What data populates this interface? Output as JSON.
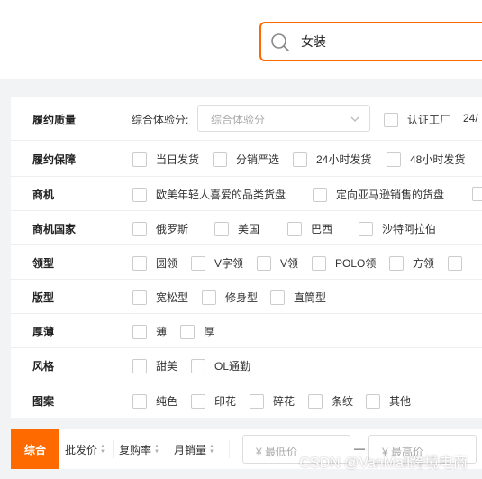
{
  "search": {
    "query": "女装"
  },
  "filters": {
    "fulfillment_quality": {
      "label": "履约质量",
      "select_label": "综合体验分:",
      "select_value": "综合体验分",
      "options": [
        "认证工厂",
        "24/"
      ]
    },
    "fulfillment_guarantee": {
      "label": "履约保障",
      "options": [
        "当日发货",
        "分销严选",
        "24小时发货",
        "48小时发货"
      ]
    },
    "opportunity": {
      "label": "商机",
      "options": [
        "欧美年轻人喜爱的品类货盘",
        "定向亚马逊销售的货盘"
      ]
    },
    "opportunity_country": {
      "label": "商机国家",
      "options": [
        "俄罗斯",
        "美国",
        "巴西",
        "沙特阿拉伯"
      ]
    },
    "collar": {
      "label": "领型",
      "options": [
        "圆领",
        "V字领",
        "V领",
        "POLO领",
        "方领",
        "一"
      ]
    },
    "fit": {
      "label": "版型",
      "options": [
        "宽松型",
        "修身型",
        "直筒型"
      ]
    },
    "thickness": {
      "label": "厚薄",
      "options": [
        "薄",
        "厚"
      ]
    },
    "style": {
      "label": "风格",
      "options": [
        "甜美",
        "OL通勤"
      ]
    },
    "pattern": {
      "label": "图案",
      "options": [
        "纯色",
        "印花",
        "碎花",
        "条纹",
        "其他"
      ]
    }
  },
  "sort": {
    "active": "综合",
    "items": [
      "批发价",
      "复购率",
      "月销量"
    ],
    "min_price_placeholder": "¥ 最低价",
    "separator": "—",
    "max_price_placeholder": "¥ 最高价"
  },
  "watermark": "CSDN @VanMall跨境电商",
  "colors": {
    "accent": "#ff6a00"
  }
}
